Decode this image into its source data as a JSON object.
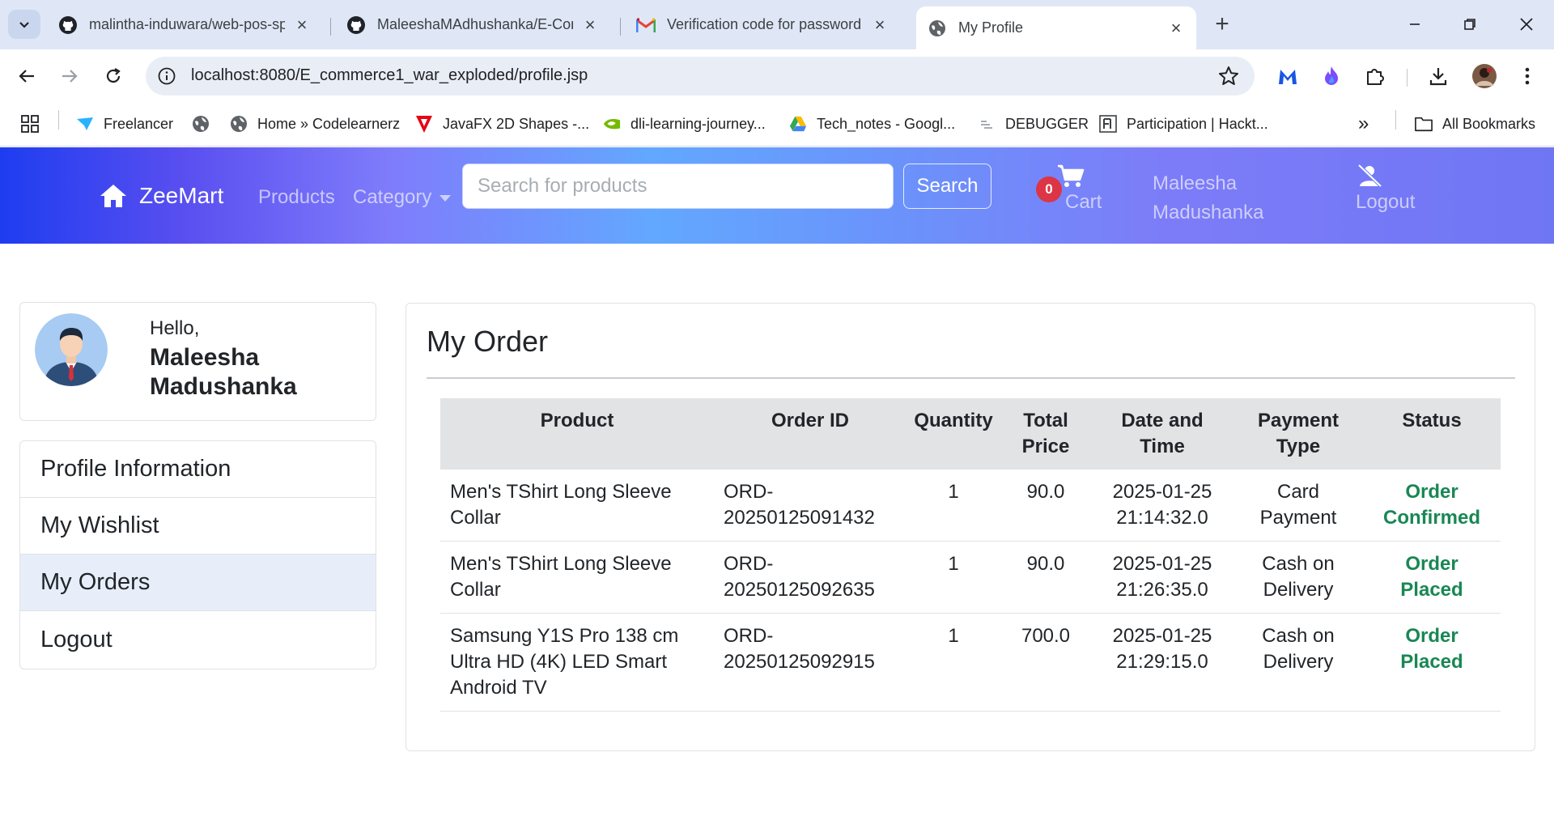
{
  "browser": {
    "tabs": [
      {
        "title": "malintha-induwara/web-pos-sp",
        "icon": "github-icon",
        "active": false
      },
      {
        "title": "MaleeshaMAdhushanka/E-Com",
        "icon": "github-icon",
        "active": false
      },
      {
        "title": "Verification code for password c",
        "icon": "gmail-icon",
        "active": false
      },
      {
        "title": "My Profile",
        "icon": "globe-icon",
        "active": true
      }
    ],
    "url": "localhost:8080/E_commerce1_war_exploded/profile.jsp",
    "bookmarks": [
      {
        "label": "Freelancer",
        "icon": "freelancer-icon"
      },
      {
        "label": "",
        "icon": "globe-icon"
      },
      {
        "label": "Home » Codelearnerz",
        "icon": "globe-icon"
      },
      {
        "label": "JavaFX 2D Shapes -...",
        "icon": "javafx-icon"
      },
      {
        "label": "dli-learning-journey...",
        "icon": "nvidia-icon"
      },
      {
        "label": "Tech_notes - Googl...",
        "icon": "google-drive-icon"
      },
      {
        "label": "DEBUGGER",
        "icon": "debugger-icon"
      },
      {
        "label": "Participation | Hackt...",
        "icon": "hackathon-icon"
      }
    ],
    "all_bookmarks_label": "All Bookmarks",
    "overflow_label": "»"
  },
  "navbar": {
    "brand": "ZeeMart",
    "products_label": "Products",
    "category_label": "Category",
    "search_placeholder": "Search for products",
    "search_button": "Search",
    "cart_count": "0",
    "cart_label": "Cart",
    "user_name": "Maleesha Madushanka",
    "logout_label": "Logout"
  },
  "profile": {
    "greeting": "Hello,",
    "name": "Maleesha Madushanka"
  },
  "menu": {
    "items": [
      {
        "label": "Profile Information",
        "active": false
      },
      {
        "label": "My Wishlist",
        "active": false
      },
      {
        "label": "My Orders",
        "active": true
      },
      {
        "label": "Logout",
        "active": false
      }
    ]
  },
  "orders": {
    "title": "My Order",
    "columns": [
      "Product",
      "Order ID",
      "Quantity",
      "Total Price",
      "Date and Time",
      "Payment Type",
      "Status"
    ],
    "rows": [
      {
        "product": "Men's TShirt Long Sleeve Collar",
        "order_id": "ORD-20250125091432",
        "quantity": "1",
        "total": "90.0",
        "datetime": "2025-01-25 21:14:32.0",
        "payment": "Card Payment",
        "status": "Order Confirmed"
      },
      {
        "product": "Men's TShirt Long Sleeve Collar",
        "order_id": "ORD-20250125092635",
        "quantity": "1",
        "total": "90.0",
        "datetime": "2025-01-25 21:26:35.0",
        "payment": "Cash on Delivery",
        "status": "Order Placed"
      },
      {
        "product": "Samsung Y1S Pro 138 cm Ultra HD (4K) LED Smart Android TV",
        "order_id": "ORD-20250125092915",
        "quantity": "1",
        "total": "700.0",
        "datetime": "2025-01-25 21:29:15.0",
        "payment": "Cash on Delivery",
        "status": "Order Placed"
      }
    ]
  },
  "colors": {
    "status_green": "#198754",
    "badge_red": "#dc3545",
    "menu_active_bg": "#e7eef9"
  }
}
